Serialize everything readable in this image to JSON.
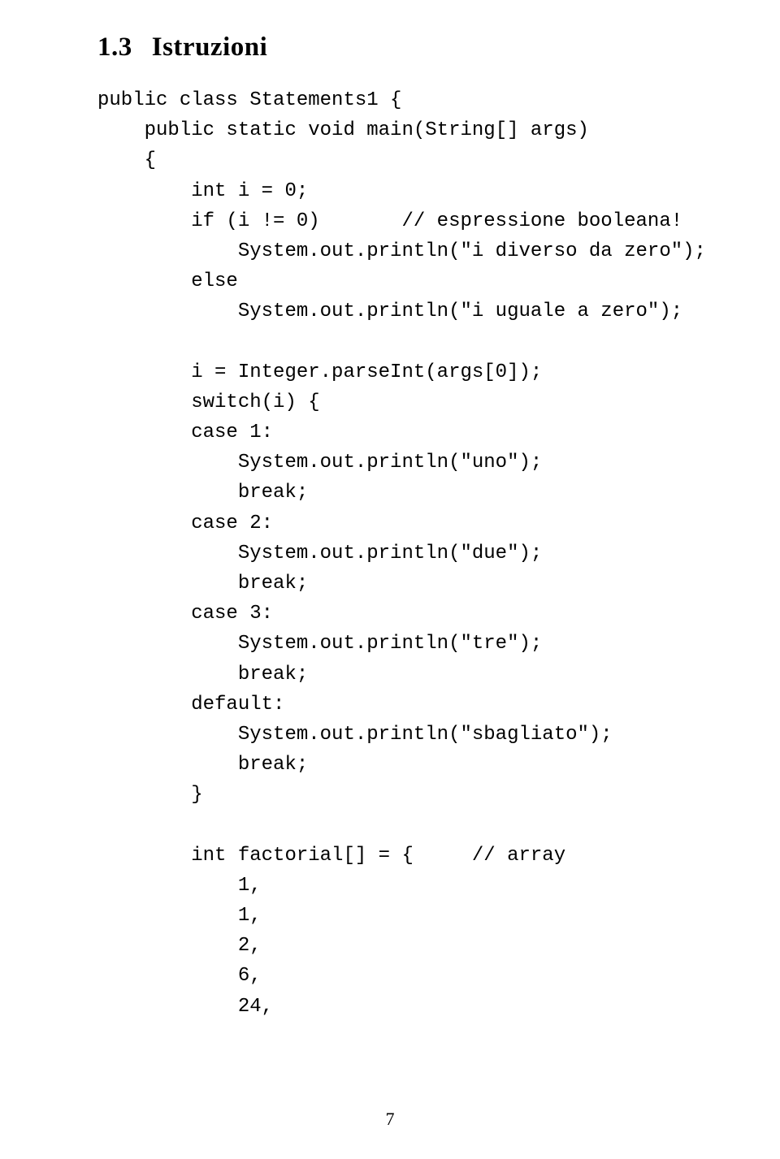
{
  "heading": {
    "number": "1.3",
    "title": "Istruzioni"
  },
  "code": {
    "l01": "public class Statements1 {",
    "l02": "    public static void main(String[] args)",
    "l03": "    {",
    "l04": "        int i = 0;",
    "l05": "        if (i != 0)       // espressione booleana!",
    "l06": "            System.out.println(\"i diverso da zero\");",
    "l07": "        else",
    "l08": "            System.out.println(\"i uguale a zero\");",
    "l09": "",
    "l10": "        i = Integer.parseInt(args[0]);",
    "l11": "        switch(i) {",
    "l12": "        case 1:",
    "l13": "            System.out.println(\"uno\");",
    "l14": "            break;",
    "l15": "        case 2:",
    "l16": "            System.out.println(\"due\");",
    "l17": "            break;",
    "l18": "        case 3:",
    "l19": "            System.out.println(\"tre\");",
    "l20": "            break;",
    "l21": "        default:",
    "l22": "            System.out.println(\"sbagliato\");",
    "l23": "            break;",
    "l24": "        }",
    "l25": "",
    "l26": "        int factorial[] = {     // array",
    "l27": "            1,",
    "l28": "            1,",
    "l29": "            2,",
    "l30": "            6,",
    "l31": "            24,"
  },
  "page_number": "7"
}
